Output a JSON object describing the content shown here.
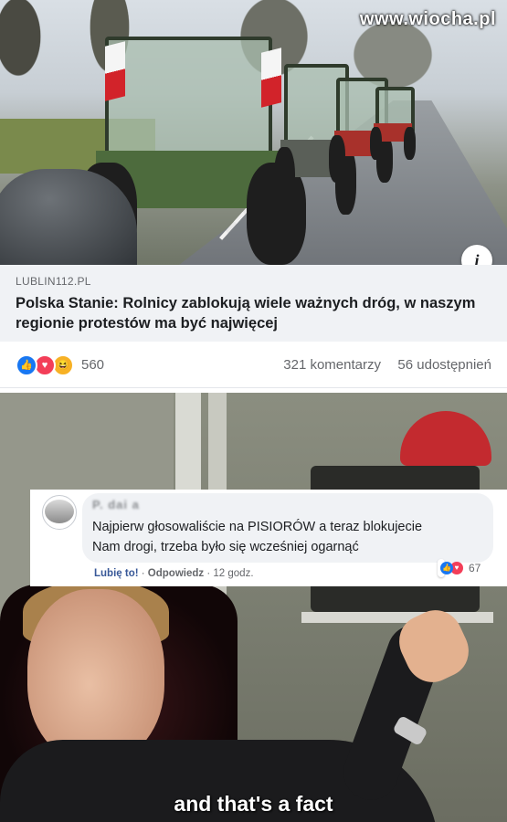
{
  "watermark": "www.wiocha.pl",
  "post": {
    "link_domain": "LUBLIN112.PL",
    "link_title": "Polska Stanie: Rolnicy zablokują wiele ważnych dróg, w naszym regionie protestów ma być najwięcej",
    "info_icon": "i",
    "reaction_count": "560",
    "comments_count": "321 komentarzy",
    "shares_count": "56 udostępnień",
    "reactions": [
      "like-icon",
      "love-icon",
      "haha-icon"
    ],
    "colors": {
      "like": "#1877f2",
      "love": "#f33e58",
      "haha": "#f7b125"
    }
  },
  "comment": {
    "author": "P. dai a",
    "text_line1": "Najpierw głosowaliście na PISIORÓW a teraz blokujecie",
    "text_line2": "Nam drogi, trzeba było się wcześniej ogarnąć",
    "like_action": "Lubię to!",
    "separator1": "·",
    "reply_action": "Odpowiedz",
    "separator2": "·",
    "time": "12 godz.",
    "reaction_count": "67"
  },
  "meme": {
    "subtitle": "and that's a fact"
  }
}
